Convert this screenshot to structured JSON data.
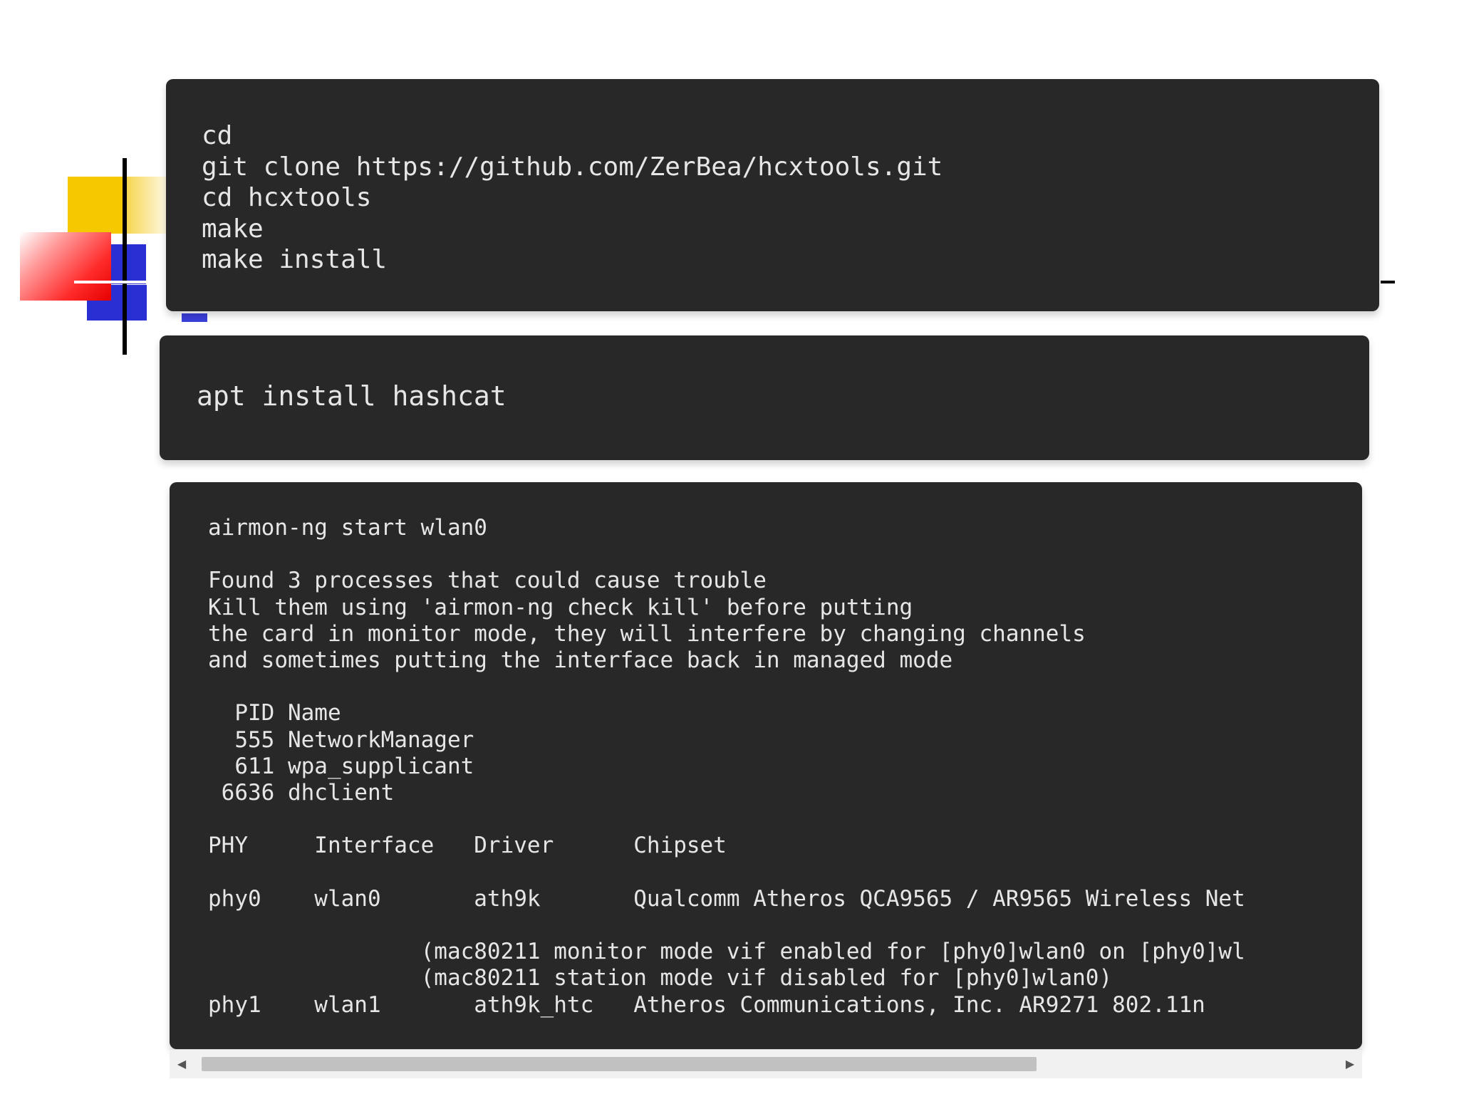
{
  "install_hcxtools": {
    "lines": [
      "cd",
      "git clone https://github.com/ZerBea/hcxtools.git",
      "cd hcxtools",
      "make",
      "make install"
    ]
  },
  "install_hashcat": {
    "lines": [
      "apt install hashcat"
    ]
  },
  "airmon_output": {
    "lines": [
      "airmon-ng start wlan0",
      "",
      "Found 3 processes that could cause trouble",
      "Kill them using 'airmon-ng check kill' before putting",
      "the card in monitor mode, they will interfere by changing channels",
      "and sometimes putting the interface back in managed mode",
      "",
      "  PID Name",
      "  555 NetworkManager",
      "  611 wpa_supplicant",
      " 6636 dhclient",
      "",
      "PHY     Interface   Driver      Chipset",
      "",
      "phy0    wlan0       ath9k       Qualcomm Atheros QCA9565 / AR9565 Wireless Net",
      "",
      "                (mac80211 monitor mode vif enabled for [phy0]wlan0 on [phy0]wl",
      "                (mac80211 station mode vif disabled for [phy0]wlan0)",
      "phy1    wlan1       ath9k_htc   Atheros Communications, Inc. AR9271 802.11n"
    ]
  },
  "scrollbar": {
    "left_arrow": "◀",
    "right_arrow": "▶",
    "thumb_fraction": 0.74
  },
  "colors": {
    "code_background": "#282828",
    "code_text": "#e6e6e6",
    "accent_yellow": "#f6c800",
    "accent_blue": "#2a2fd3",
    "accent_red": "#e60000"
  }
}
